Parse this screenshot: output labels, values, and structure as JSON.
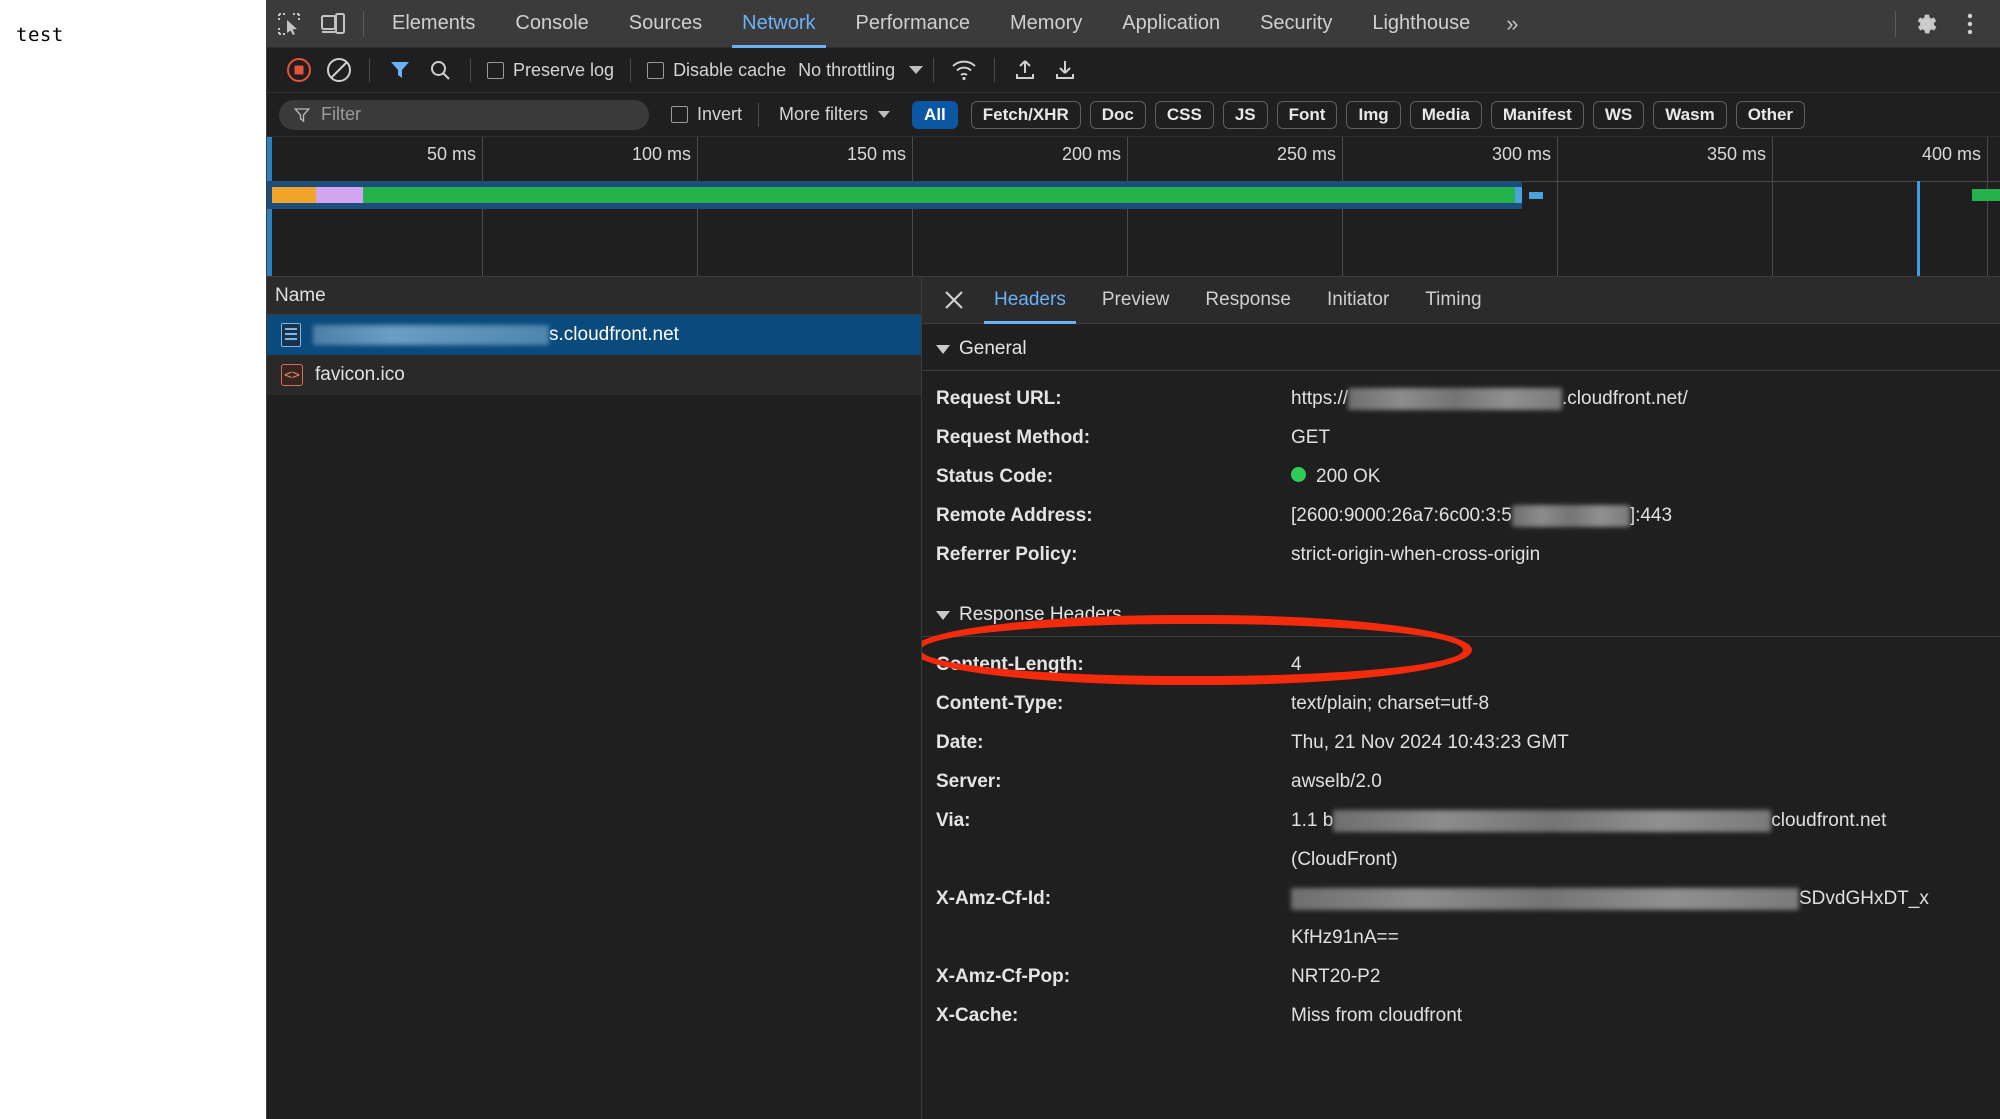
{
  "page": {
    "content_text": "test"
  },
  "devtools": {
    "toolbar_icons": [
      {
        "name": "inspect-element-icon"
      },
      {
        "name": "device-toolbar-icon"
      }
    ],
    "panels": [
      {
        "label": "Elements",
        "active": false
      },
      {
        "label": "Console",
        "active": false
      },
      {
        "label": "Sources",
        "active": false
      },
      {
        "label": "Network",
        "active": true
      },
      {
        "label": "Performance",
        "active": false
      },
      {
        "label": "Memory",
        "active": false
      },
      {
        "label": "Application",
        "active": false
      },
      {
        "label": "Security",
        "active": false
      },
      {
        "label": "Lighthouse",
        "active": false
      }
    ],
    "more_tabs_label": "»",
    "settings_icon": "gear-icon",
    "menu_icon": "kebab-menu-icon",
    "network_toolbar": {
      "record_icon": "record-stop-icon",
      "clear_icon": "clear-network-log-icon",
      "filter_icon": "filter-funnel-icon",
      "search_icon": "search-magnifier-icon",
      "preserve_log_label": "Preserve log",
      "preserve_log_checked": false,
      "disable_cache_label": "Disable cache",
      "disable_cache_checked": false,
      "throttling_label": "No throttling",
      "wifi_icon": "network-conditions-wifi-icon",
      "import_icon": "import-har-upload-icon",
      "export_icon": "export-har-download-icon"
    },
    "filter_row": {
      "filter_placeholder": "Filter",
      "filter_value": "",
      "filter_icon": "filter-funnel-icon",
      "invert_label": "Invert",
      "invert_checked": false,
      "more_filters_label": "More filters",
      "resource_types": [
        {
          "label": "All",
          "active": true
        },
        {
          "label": "Fetch/XHR",
          "active": false
        },
        {
          "label": "Doc",
          "active": false
        },
        {
          "label": "CSS",
          "active": false
        },
        {
          "label": "JS",
          "active": false
        },
        {
          "label": "Font",
          "active": false
        },
        {
          "label": "Img",
          "active": false
        },
        {
          "label": "Media",
          "active": false
        },
        {
          "label": "Manifest",
          "active": false
        },
        {
          "label": "WS",
          "active": false
        },
        {
          "label": "Wasm",
          "active": false
        },
        {
          "label": "Other",
          "active": false
        }
      ]
    },
    "overview": {
      "ticks": [
        "50 ms",
        "100 ms",
        "150 ms",
        "200 ms",
        "250 ms",
        "300 ms",
        "350 ms",
        "400 ms"
      ],
      "colors": {
        "waiting": "#f0a42a",
        "stalled": "#d3a4f0",
        "download": "#25b14c",
        "receiving": "#4aa2de",
        "marker_blue": "#3b9de8"
      }
    },
    "requests": {
      "column_header": "Name",
      "rows": [
        {
          "icon": "document-file-icon",
          "redacted_prefix": true,
          "name": "s.cloudfront.net",
          "selected": true
        },
        {
          "icon": "favicon-file-icon",
          "redacted_prefix": false,
          "name": "favicon.ico",
          "selected": false
        }
      ]
    },
    "details": {
      "close_icon": "close-x-icon",
      "tabs": [
        {
          "label": "Headers",
          "active": true
        },
        {
          "label": "Preview",
          "active": false
        },
        {
          "label": "Response",
          "active": false
        },
        {
          "label": "Initiator",
          "active": false
        },
        {
          "label": "Timing",
          "active": false
        }
      ],
      "sections": [
        {
          "title": "General",
          "rows": [
            {
              "key": "Request URL:",
              "value_pre": "https://",
              "redacted": true,
              "value_post": ".cloudfront.net/"
            },
            {
              "key": "Request Method:",
              "value": "GET"
            },
            {
              "key": "Status Code:",
              "value": "200 OK",
              "status_dot": "#2ecc57"
            },
            {
              "key": "Remote Address:",
              "value_pre": "[2600:9000:26a7:6c00:3:5",
              "redacted": true,
              "value_post": "]:443"
            },
            {
              "key": "Referrer Policy:",
              "value": "strict-origin-when-cross-origin"
            }
          ]
        },
        {
          "title": "Response Headers",
          "rows": [
            {
              "key": "Content-Length:",
              "value": "4"
            },
            {
              "key": "Content-Type:",
              "value": "text/plain; charset=utf-8"
            },
            {
              "key": "Date:",
              "value": "Thu, 21 Nov 2024 10:43:23 GMT"
            },
            {
              "key": "Server:",
              "value": "awselb/2.0",
              "highlighted": true
            },
            {
              "key": "Via:",
              "value_pre": "1.1 b",
              "redacted": true,
              "value_post": "cloudfront.net"
            },
            {
              "key": "",
              "value": "(CloudFront)",
              "continuation": true
            },
            {
              "key": "X-Amz-Cf-Id:",
              "redacted": true,
              "value_post": "SDvdGHxDT_x"
            },
            {
              "key": "",
              "value": "KfHz91nA==",
              "continuation": true
            },
            {
              "key": "X-Amz-Cf-Pop:",
              "value": "NRT20-P2"
            },
            {
              "key": "X-Cache:",
              "value": "Miss from cloudfront"
            }
          ]
        }
      ],
      "annotation": {
        "shape": "ellipse",
        "color": "#f42a0d",
        "target": "Server: awselb/2.0"
      }
    }
  }
}
